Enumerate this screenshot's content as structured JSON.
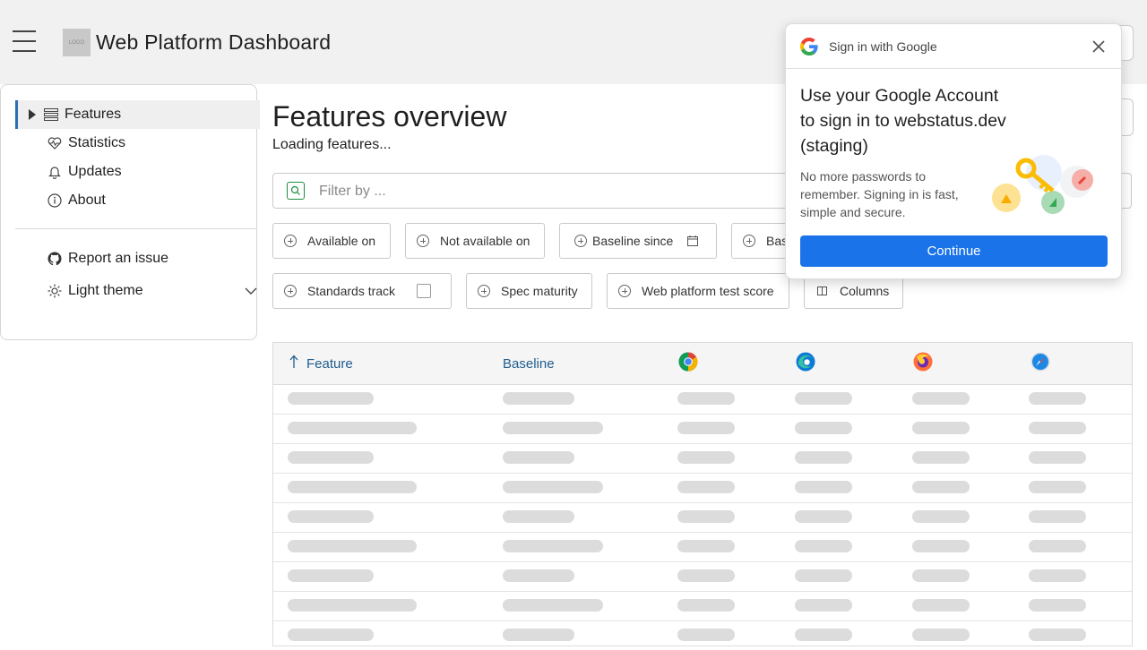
{
  "header": {
    "title": "Web Platform Dashboard",
    "logo_text": "LOGO"
  },
  "sidebar": {
    "items": [
      {
        "label": "Features",
        "icon": "list-icon"
      },
      {
        "label": "Statistics",
        "icon": "heartbeat-icon"
      },
      {
        "label": "Updates",
        "icon": "bell-icon"
      },
      {
        "label": "About",
        "icon": "info-icon"
      }
    ],
    "secondary": [
      {
        "label": "Report an issue",
        "icon": "github-icon"
      },
      {
        "label": "Light theme",
        "icon": "sun-icon"
      }
    ]
  },
  "main": {
    "title": "Features overview",
    "status": "Loading features...",
    "filter_placeholder": "Filter by ...",
    "chips_row1": [
      "Available on",
      "Not available on",
      "Baseline since",
      "Bas"
    ],
    "chips_row2": [
      "Standards track",
      "Spec maturity",
      "Web platform test score",
      "Columns"
    ]
  },
  "table": {
    "columns": [
      "Feature",
      "Baseline"
    ],
    "browsers": [
      "chrome-icon",
      "edge-icon",
      "firefox-icon",
      "safari-icon"
    ],
    "loading_rows": 9
  },
  "google_dialog": {
    "title": "Sign in with Google",
    "heading": "Use your Google Account to sign in to webstatus.dev (staging)",
    "body": "No more passwords to remember. Signing in is fast, simple and secure.",
    "button": "Continue",
    "button_color": "#1a73e8"
  }
}
